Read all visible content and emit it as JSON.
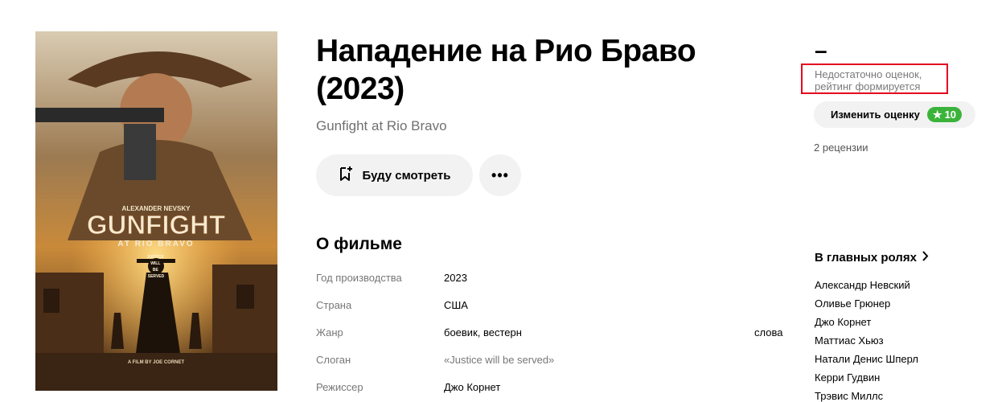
{
  "movie": {
    "title": "Нападение на Рио Браво (2023)",
    "original_title": "Gunfight at Rio Bravo"
  },
  "poster": {
    "actor_credit": "ALEXANDER NEVSKY",
    "logo_main": "GUNFIGHT",
    "logo_sub": "AT RIO BRAVO",
    "tagline_lines": [
      "JUSTICE",
      "WILL",
      "BE",
      "SERVED"
    ],
    "director_credit": "A FILM BY JOE CORNET"
  },
  "actions": {
    "watch_later_label": "Буду смотреть",
    "more_label": "•••"
  },
  "about": {
    "heading": "О фильме",
    "rows": [
      {
        "label": "Год производства",
        "value": "2023"
      },
      {
        "label": "Страна",
        "value": "США"
      },
      {
        "label": "Жанр",
        "value": "боевик, вестерн",
        "extra": "слова"
      },
      {
        "label": "Слоган",
        "value": "«Justice will be served»"
      },
      {
        "label": "Режиссер",
        "value": "Джо Корнет"
      }
    ]
  },
  "rating": {
    "value": "–",
    "note": "Недостаточно оценок, рейтинг формируется",
    "change_label": "Изменить оценку",
    "user_score": "10",
    "reviews": "2 рецензии"
  },
  "cast": {
    "heading": "В главных ролях",
    "names": [
      "Александр Невский",
      "Оливье Грюнер",
      "Джо Корнет",
      "Маттиас Хьюз",
      "Натали Денис Шперл",
      "Керри Гудвин",
      "Трэвис Миллс"
    ]
  },
  "colors": {
    "highlight_border": "#e5001f",
    "score_badge": "#3bb33b",
    "button_bg": "#f2f2f2"
  }
}
